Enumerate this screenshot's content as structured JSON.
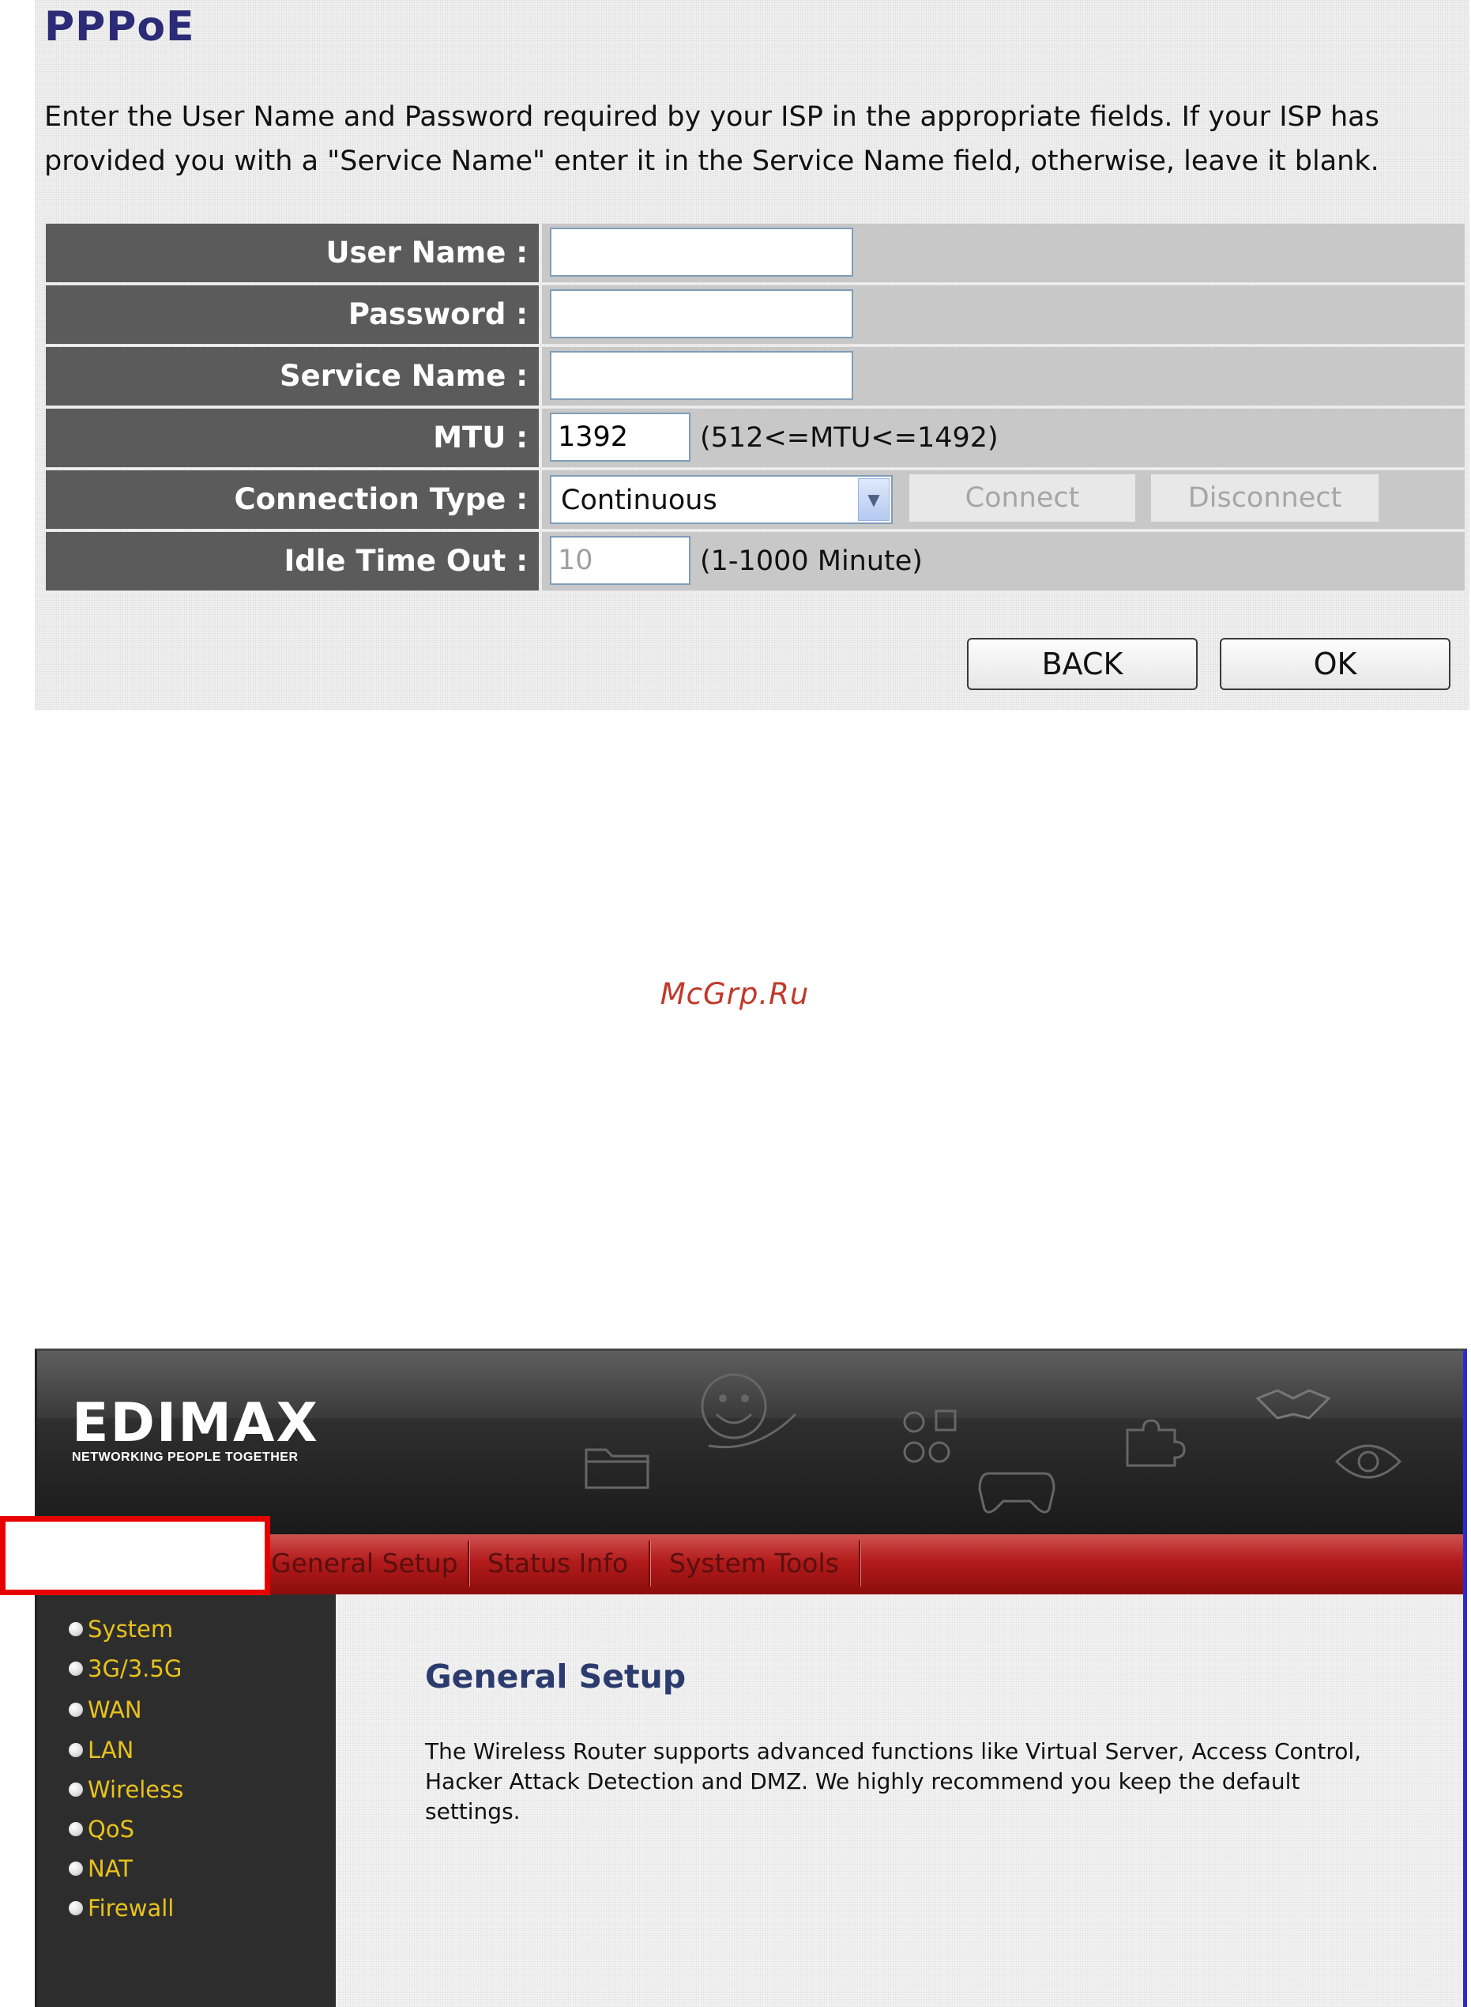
{
  "pppoe": {
    "title": "PPPoE",
    "description": "Enter the User Name and Password required by your ISP in the appropriate fields. If your ISP has provided you with a \"Service Name\" enter it in the Service Name field, otherwise, leave it blank.",
    "fields": {
      "user_name_label": "User Name :",
      "user_name_value": "",
      "password_label": "Password :",
      "password_value": "",
      "service_name_label": "Service Name :",
      "service_name_value": "",
      "mtu_label": "MTU :",
      "mtu_value": "1392",
      "mtu_hint": "(512<=MTU<=1492)",
      "connection_type_label": "Connection Type :",
      "connection_type_value": "Continuous",
      "connect_label": "Connect",
      "disconnect_label": "Disconnect",
      "idle_timeout_label": "Idle Time Out :",
      "idle_timeout_value": "10",
      "idle_timeout_hint": "(1-1000 Minute)"
    },
    "buttons": {
      "back": "BACK",
      "ok": "OK"
    }
  },
  "watermark": "McGrp.Ru",
  "router": {
    "brand": "EDIMAX",
    "tagline": "NETWORKING PEOPLE TOGETHER",
    "menu": [
      "General Setup",
      "Status Info",
      "System Tools"
    ],
    "sidebar": [
      "System",
      "3G/3.5G",
      "WAN",
      "LAN",
      "Wireless",
      "QoS",
      "NAT",
      "Firewall"
    ],
    "content": {
      "title": "General Setup",
      "text": "The Wireless Router supports advanced functions like Virtual Server, Access Control, Hacker Attack Detection and DMZ. We highly recommend you keep the default settings."
    },
    "colors": {
      "menu_red": "#b31b1b",
      "sidebar_text": "#e8c21c",
      "highlight": "#e60000",
      "title_blue": "#2b3b6e"
    }
  }
}
